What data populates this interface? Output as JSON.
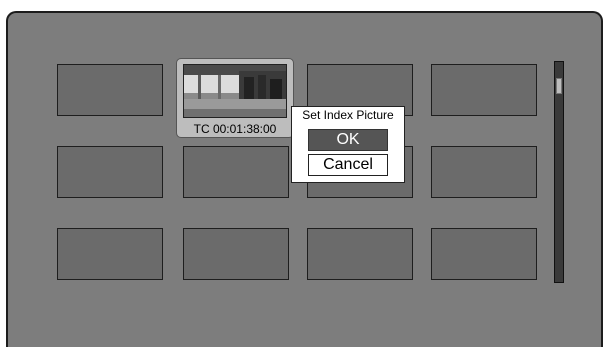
{
  "grid": {
    "selected_timecode": "TC 00:01:38:00",
    "thumbnail_count": 12,
    "selected_index": 1
  },
  "dialog": {
    "title": "Set Index Picture",
    "ok_label": "OK",
    "cancel_label": "Cancel",
    "focused": "OK"
  },
  "colors": {
    "panel": "#7d7d7d",
    "thumbnail": "#6b6b6b",
    "highlight": "#555555"
  }
}
